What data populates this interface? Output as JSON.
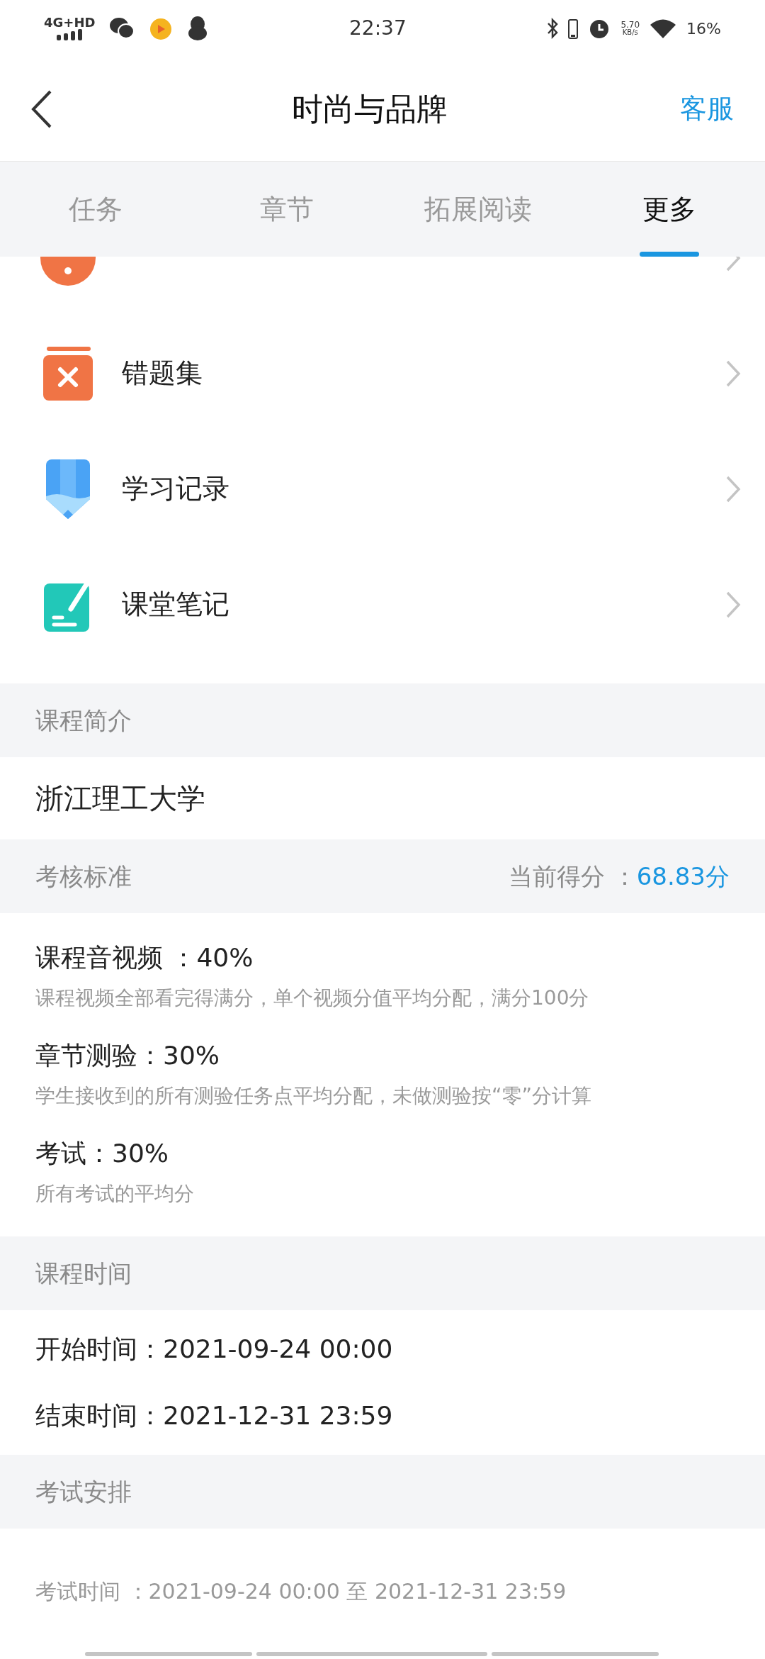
{
  "status_bar": {
    "network": "4G+HD",
    "time": "22:37",
    "speed_value": "5.70",
    "speed_unit": "KB/s",
    "battery": "16%"
  },
  "header": {
    "title": "时尚与品牌",
    "action": "客服"
  },
  "tabs": [
    {
      "label": "任务",
      "selected": false
    },
    {
      "label": "章节",
      "selected": false
    },
    {
      "label": "拓展阅读",
      "selected": false
    },
    {
      "label": "更多",
      "selected": true
    }
  ],
  "menu_items": [
    {
      "kind": "question"
    },
    {
      "kind": "wrong",
      "label": "错题集"
    },
    {
      "kind": "record",
      "label": "学习记录"
    },
    {
      "kind": "notes",
      "label": "课堂笔记"
    }
  ],
  "intro": {
    "heading": "课程简介",
    "text": "浙江理工大学"
  },
  "assessment": {
    "heading": "考核标准",
    "score_label": "当前得分 ：",
    "score_value": "68.83分",
    "criteria": [
      {
        "title": "课程音视频 ：40%",
        "description": "课程视频全部看完得满分，单个视频分值平均分配，满分100分"
      },
      {
        "title": "章节测验：30%",
        "description": "学生接收到的所有测验任务点平均分配，未做测验按“零”分计算"
      },
      {
        "title": "考试：30%",
        "description": "所有考试的平均分"
      }
    ]
  },
  "course_time": {
    "heading": "课程时间",
    "rows": [
      "开始时间：2021-09-24 00:00",
      "结束时间：2021-12-31 23:59"
    ]
  },
  "exam": {
    "heading": "考试安排",
    "text": "考试时间 ：2021-09-24 00:00 至 2021-12-31 23:59"
  }
}
